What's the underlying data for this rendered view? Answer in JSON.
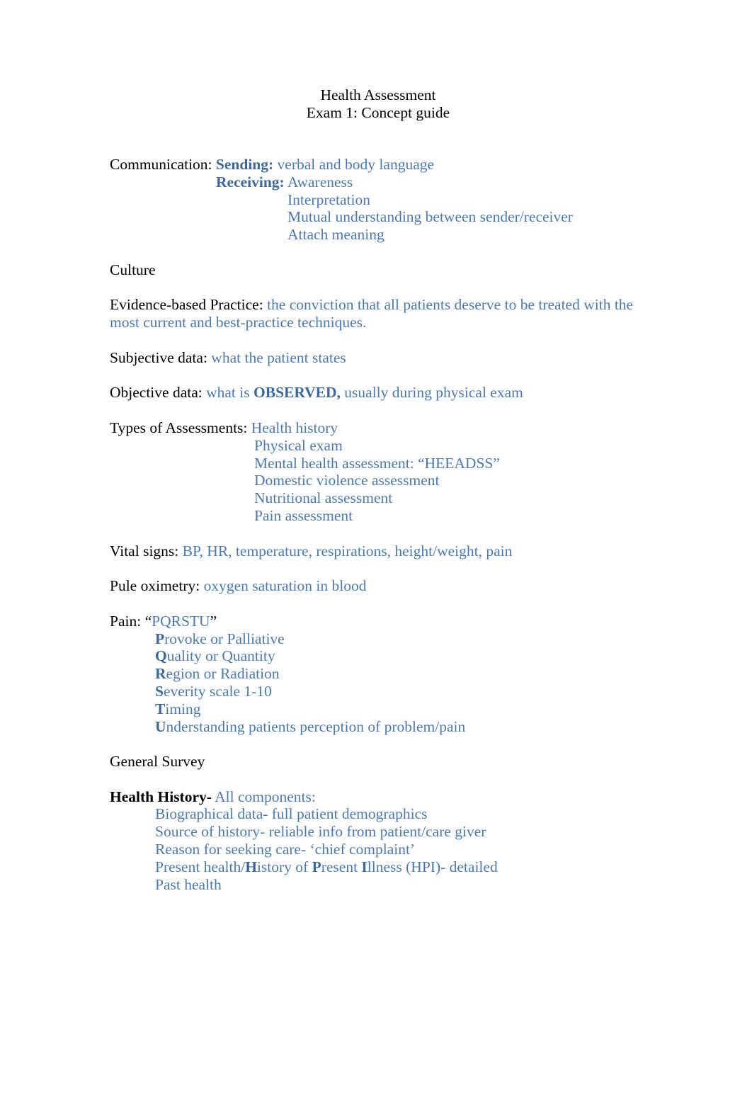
{
  "document": {
    "title_line_1": "Health Assessment",
    "title_line_2": "Exam 1: Concept guide",
    "accent_color": "#4a7ab5",
    "accent_bold_color": "#39699f",
    "body_color": "#000000",
    "background_color": "#ffffff"
  },
  "sections": {
    "communication": {
      "label": "Communication:",
      "sending_label": "Sending:",
      "sending_value": " verbal and body language",
      "receiving_label": "Receiving:",
      "receiving_value": "  Awareness",
      "receiving_items": [
        "Interpretation",
        "Mutual understanding between sender/receiver",
        "Attach meaning"
      ]
    },
    "culture": {
      "label": "Culture"
    },
    "evidence_based_practice": {
      "label": "Evidence-based Practice:",
      "value": " the conviction that all patients deserve to be treated with the most current and best-practice techniques."
    },
    "subjective_data": {
      "label": "Subjective data:",
      "value": " what the patient states"
    },
    "objective_data": {
      "label": "Objective data:",
      "value_part_1": " what is ",
      "value_emphasis": "OBSERVED,",
      "value_part_2": " usually during physical exam"
    },
    "types_of_assessments": {
      "label": "Types of Assessments:",
      "first_item": " Health history",
      "items": [
        "Physical exam",
        "Mental health assessment: “HEEADSS”",
        "Domestic violence assessment",
        "Nutritional assessment",
        "Pain assessment"
      ]
    },
    "vital_signs": {
      "label": "Vital signs:",
      "value": " BP, HR, temperature, respirations, height/weight, pain"
    },
    "pulse_oximetry": {
      "label": "Pule oximetry:",
      "value": " oxygen saturation in blood"
    },
    "pain": {
      "label": "Pain: “",
      "acronym": "PQRSTU",
      "label_close": "”",
      "items": [
        {
          "initial": "P",
          "rest": "rovoke or Palliative"
        },
        {
          "initial": "Q",
          "rest": "uality or Quantity"
        },
        {
          "initial": "R",
          "rest": "egion or Radiation"
        },
        {
          "initial": "S",
          "rest": "everity scale 1-10"
        },
        {
          "initial": "T",
          "rest": "iming"
        },
        {
          "initial": "U",
          "rest": "nderstanding patients perception of problem/pain"
        }
      ]
    },
    "general_survey": {
      "label": "General Survey"
    },
    "health_history": {
      "label": "Health History-",
      "value": "  All components:",
      "items": [
        {
          "text": "Biographical data- full patient demographics"
        },
        {
          "text": "Source of history- reliable info from patient/care giver"
        },
        {
          "text": "Reason for seeking care- ‘chief complaint’"
        },
        {
          "segments": [
            {
              "text": "Present health/",
              "bold": false
            },
            {
              "text": "H",
              "bold": true
            },
            {
              "text": "istory of ",
              "bold": false
            },
            {
              "text": "P",
              "bold": true
            },
            {
              "text": "resent ",
              "bold": false
            },
            {
              "text": "I",
              "bold": true
            },
            {
              "text": "llness (HPI)- detailed",
              "bold": false
            }
          ]
        },
        {
          "text": "Past health"
        }
      ]
    }
  }
}
